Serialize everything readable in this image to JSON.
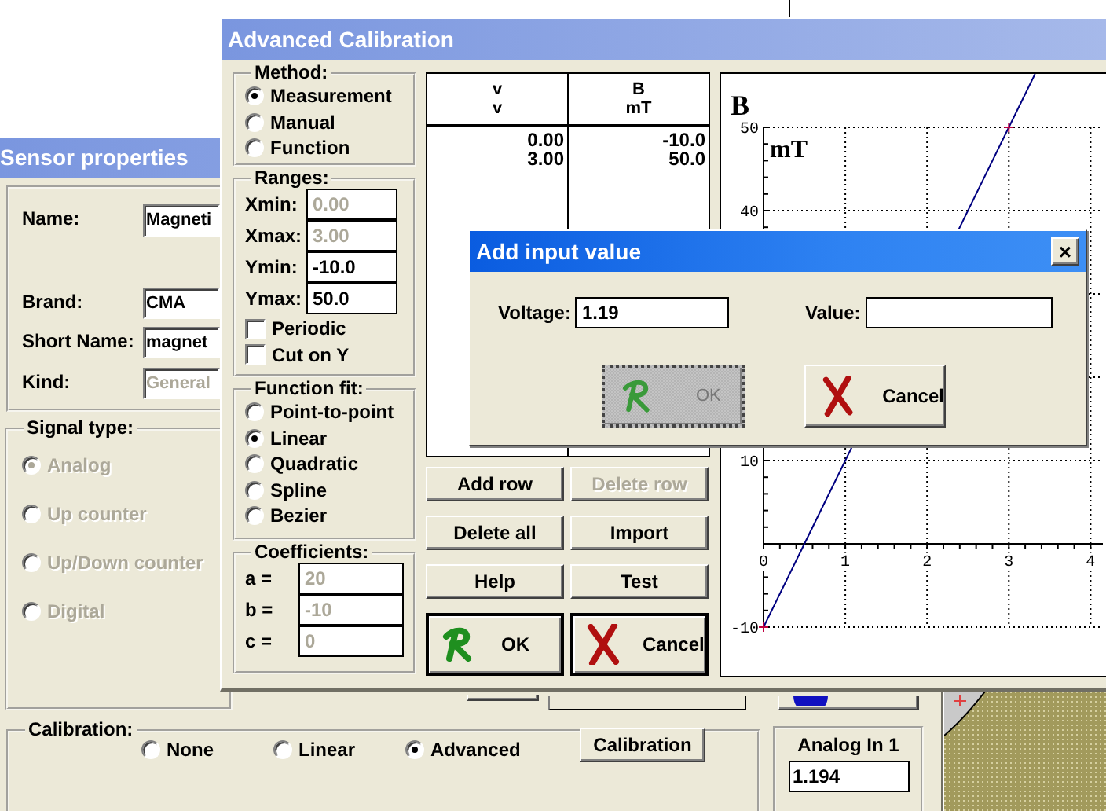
{
  "sensor_window": {
    "title": "Sensor properties",
    "fields": [
      {
        "label": "Name:",
        "value": "Magneti",
        "disabled": false
      },
      {
        "label": "Brand:",
        "value": "CMA",
        "disabled": false
      },
      {
        "label": "Short Name:",
        "value": "magnet",
        "disabled": false
      },
      {
        "label": "Kind:",
        "value": "General",
        "disabled": true
      }
    ],
    "signal_type": {
      "legend": "Signal type:",
      "options": [
        {
          "label": "Analog",
          "selected": true,
          "disabled": true
        },
        {
          "label": "Up counter",
          "selected": false,
          "disabled": true
        },
        {
          "label": "Up/Down counter",
          "selected": false,
          "disabled": true
        },
        {
          "label": "Digital",
          "selected": false,
          "disabled": true
        }
      ]
    },
    "calibration": {
      "legend": "Calibration:",
      "options": [
        {
          "label": "None",
          "selected": false
        },
        {
          "label": "Linear",
          "selected": false
        },
        {
          "label": "Advanced",
          "selected": true
        }
      ],
      "button": "Calibration"
    },
    "input_panel": {
      "label": "Analog In 1",
      "value": "1.194"
    }
  },
  "calibration_window": {
    "title": "Advanced Calibration",
    "method": {
      "legend": "Method:",
      "options": [
        {
          "label": "Measurement",
          "selected": true
        },
        {
          "label": "Manual",
          "selected": false
        },
        {
          "label": "Function",
          "selected": false
        }
      ]
    },
    "ranges": {
      "legend": "Ranges:",
      "fields": [
        {
          "label": "Xmin:",
          "value": "0.00",
          "disabled": true
        },
        {
          "label": "Xmax:",
          "value": "3.00",
          "disabled": true
        },
        {
          "label": "Ymin:",
          "value": "-10.0",
          "disabled": false
        },
        {
          "label": "Ymax:",
          "value": "50.0",
          "disabled": false
        }
      ],
      "checkboxes": [
        {
          "label": "Periodic",
          "checked": false
        },
        {
          "label": "Cut on Y",
          "checked": false
        }
      ]
    },
    "function_fit": {
      "legend": "Function fit:",
      "options": [
        {
          "label": "Point-to-point",
          "selected": false
        },
        {
          "label": "Linear",
          "selected": true
        },
        {
          "label": "Quadratic",
          "selected": false
        },
        {
          "label": "Spline",
          "selected": false
        },
        {
          "label": "Bezier",
          "selected": false
        }
      ]
    },
    "coefficients": {
      "legend": "Coefficients:",
      "fields": [
        {
          "label": "a =",
          "value": "20",
          "disabled": true
        },
        {
          "label": "b =",
          "value": "-10",
          "disabled": true
        },
        {
          "label": "c =",
          "value": "0",
          "disabled": true
        }
      ]
    },
    "table": {
      "columns": [
        {
          "name": "v",
          "unit": "v"
        },
        {
          "name": "B",
          "unit": "mT"
        }
      ],
      "rows": [
        [
          "0.00",
          "-10.0"
        ],
        [
          "3.00",
          "50.0"
        ]
      ]
    },
    "buttons": [
      {
        "label": "Add row",
        "kind": "plain",
        "disabled": false
      },
      {
        "label": "Delete row",
        "kind": "plain",
        "disabled": true
      },
      {
        "label": "Delete all",
        "kind": "plain",
        "disabled": false
      },
      {
        "label": "Import",
        "kind": "plain",
        "disabled": false
      },
      {
        "label": "Help",
        "kind": "plain",
        "disabled": false
      },
      {
        "label": "Test",
        "kind": "plain",
        "disabled": false
      },
      {
        "label": "OK",
        "kind": "ok",
        "disabled": false
      },
      {
        "label": "Cancel",
        "kind": "cancel",
        "disabled": false
      }
    ],
    "chart": {
      "unit_label": "mT",
      "chart_data": {
        "type": "line",
        "ylabel": "B",
        "x": [
          0,
          3
        ],
        "series": [
          {
            "color": "#000080",
            "values": [
              -10,
              50
            ]
          }
        ],
        "xlim": [
          0,
          4.15
        ],
        "ylim": [
          -10,
          50
        ],
        "grid": true,
        "xticks": [
          0,
          1,
          2,
          3,
          4
        ],
        "yticks": [
          -10,
          10,
          40,
          50
        ]
      }
    }
  },
  "input_dialog": {
    "title": "Add input value",
    "close": "×",
    "fields": [
      {
        "label": "Voltage:",
        "value": "1.19"
      },
      {
        "label": "Value:"
      }
    ],
    "buttons": [
      {
        "label": "OK",
        "kind": "ok",
        "disabled": true
      },
      {
        "label": "Cancel",
        "kind": "cancel",
        "disabled": false
      }
    ]
  }
}
